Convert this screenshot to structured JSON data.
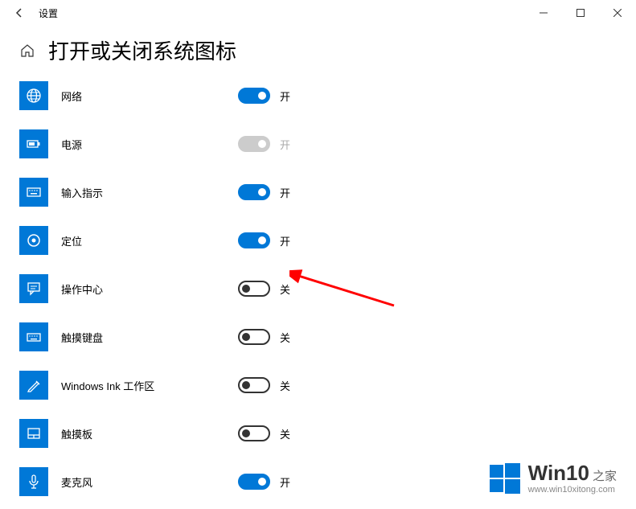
{
  "titlebar": {
    "app_name": "设置"
  },
  "header": {
    "title": "打开或关闭系统图标"
  },
  "toggle_labels": {
    "on": "开",
    "off": "关"
  },
  "items": [
    {
      "label": "网络",
      "state": "on",
      "icon": "globe"
    },
    {
      "label": "电源",
      "state": "disabled",
      "icon": "battery"
    },
    {
      "label": "输入指示",
      "state": "on",
      "icon": "keyboard"
    },
    {
      "label": "定位",
      "state": "on",
      "icon": "target"
    },
    {
      "label": "操作中心",
      "state": "off",
      "icon": "message"
    },
    {
      "label": "触摸键盘",
      "state": "off",
      "icon": "touchkb"
    },
    {
      "label": "Windows Ink 工作区",
      "state": "off",
      "icon": "ink"
    },
    {
      "label": "触摸板",
      "state": "off",
      "icon": "touchpad"
    },
    {
      "label": "麦克风",
      "state": "on",
      "icon": "mic"
    }
  ],
  "watermark": {
    "brand_main": "Win10",
    "brand_sub": "之家",
    "url": "www.win10xitong.com"
  }
}
